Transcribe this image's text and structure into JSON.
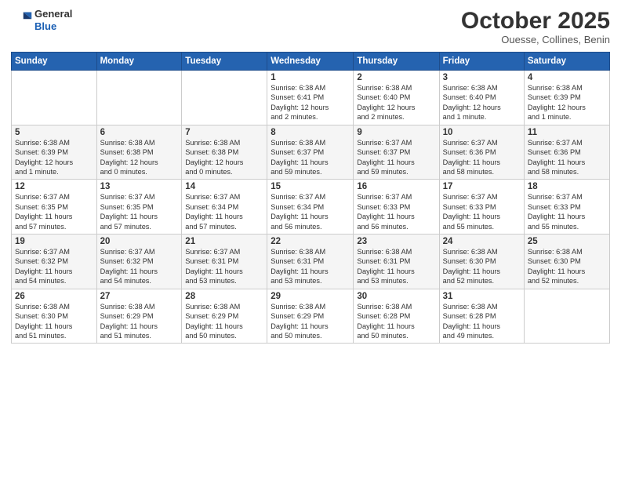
{
  "header": {
    "logo_line1": "General",
    "logo_line2": "Blue",
    "month": "October 2025",
    "location": "Ouesse, Collines, Benin"
  },
  "weekdays": [
    "Sunday",
    "Monday",
    "Tuesday",
    "Wednesday",
    "Thursday",
    "Friday",
    "Saturday"
  ],
  "weeks": [
    [
      {
        "day": "",
        "info": ""
      },
      {
        "day": "",
        "info": ""
      },
      {
        "day": "",
        "info": ""
      },
      {
        "day": "1",
        "info": "Sunrise: 6:38 AM\nSunset: 6:41 PM\nDaylight: 12 hours\nand 2 minutes."
      },
      {
        "day": "2",
        "info": "Sunrise: 6:38 AM\nSunset: 6:40 PM\nDaylight: 12 hours\nand 2 minutes."
      },
      {
        "day": "3",
        "info": "Sunrise: 6:38 AM\nSunset: 6:40 PM\nDaylight: 12 hours\nand 1 minute."
      },
      {
        "day": "4",
        "info": "Sunrise: 6:38 AM\nSunset: 6:39 PM\nDaylight: 12 hours\nand 1 minute."
      }
    ],
    [
      {
        "day": "5",
        "info": "Sunrise: 6:38 AM\nSunset: 6:39 PM\nDaylight: 12 hours\nand 1 minute."
      },
      {
        "day": "6",
        "info": "Sunrise: 6:38 AM\nSunset: 6:38 PM\nDaylight: 12 hours\nand 0 minutes."
      },
      {
        "day": "7",
        "info": "Sunrise: 6:38 AM\nSunset: 6:38 PM\nDaylight: 12 hours\nand 0 minutes."
      },
      {
        "day": "8",
        "info": "Sunrise: 6:38 AM\nSunset: 6:37 PM\nDaylight: 11 hours\nand 59 minutes."
      },
      {
        "day": "9",
        "info": "Sunrise: 6:37 AM\nSunset: 6:37 PM\nDaylight: 11 hours\nand 59 minutes."
      },
      {
        "day": "10",
        "info": "Sunrise: 6:37 AM\nSunset: 6:36 PM\nDaylight: 11 hours\nand 58 minutes."
      },
      {
        "day": "11",
        "info": "Sunrise: 6:37 AM\nSunset: 6:36 PM\nDaylight: 11 hours\nand 58 minutes."
      }
    ],
    [
      {
        "day": "12",
        "info": "Sunrise: 6:37 AM\nSunset: 6:35 PM\nDaylight: 11 hours\nand 57 minutes."
      },
      {
        "day": "13",
        "info": "Sunrise: 6:37 AM\nSunset: 6:35 PM\nDaylight: 11 hours\nand 57 minutes."
      },
      {
        "day": "14",
        "info": "Sunrise: 6:37 AM\nSunset: 6:34 PM\nDaylight: 11 hours\nand 57 minutes."
      },
      {
        "day": "15",
        "info": "Sunrise: 6:37 AM\nSunset: 6:34 PM\nDaylight: 11 hours\nand 56 minutes."
      },
      {
        "day": "16",
        "info": "Sunrise: 6:37 AM\nSunset: 6:33 PM\nDaylight: 11 hours\nand 56 minutes."
      },
      {
        "day": "17",
        "info": "Sunrise: 6:37 AM\nSunset: 6:33 PM\nDaylight: 11 hours\nand 55 minutes."
      },
      {
        "day": "18",
        "info": "Sunrise: 6:37 AM\nSunset: 6:33 PM\nDaylight: 11 hours\nand 55 minutes."
      }
    ],
    [
      {
        "day": "19",
        "info": "Sunrise: 6:37 AM\nSunset: 6:32 PM\nDaylight: 11 hours\nand 54 minutes."
      },
      {
        "day": "20",
        "info": "Sunrise: 6:37 AM\nSunset: 6:32 PM\nDaylight: 11 hours\nand 54 minutes."
      },
      {
        "day": "21",
        "info": "Sunrise: 6:37 AM\nSunset: 6:31 PM\nDaylight: 11 hours\nand 53 minutes."
      },
      {
        "day": "22",
        "info": "Sunrise: 6:38 AM\nSunset: 6:31 PM\nDaylight: 11 hours\nand 53 minutes."
      },
      {
        "day": "23",
        "info": "Sunrise: 6:38 AM\nSunset: 6:31 PM\nDaylight: 11 hours\nand 53 minutes."
      },
      {
        "day": "24",
        "info": "Sunrise: 6:38 AM\nSunset: 6:30 PM\nDaylight: 11 hours\nand 52 minutes."
      },
      {
        "day": "25",
        "info": "Sunrise: 6:38 AM\nSunset: 6:30 PM\nDaylight: 11 hours\nand 52 minutes."
      }
    ],
    [
      {
        "day": "26",
        "info": "Sunrise: 6:38 AM\nSunset: 6:30 PM\nDaylight: 11 hours\nand 51 minutes."
      },
      {
        "day": "27",
        "info": "Sunrise: 6:38 AM\nSunset: 6:29 PM\nDaylight: 11 hours\nand 51 minutes."
      },
      {
        "day": "28",
        "info": "Sunrise: 6:38 AM\nSunset: 6:29 PM\nDaylight: 11 hours\nand 50 minutes."
      },
      {
        "day": "29",
        "info": "Sunrise: 6:38 AM\nSunset: 6:29 PM\nDaylight: 11 hours\nand 50 minutes."
      },
      {
        "day": "30",
        "info": "Sunrise: 6:38 AM\nSunset: 6:28 PM\nDaylight: 11 hours\nand 50 minutes."
      },
      {
        "day": "31",
        "info": "Sunrise: 6:38 AM\nSunset: 6:28 PM\nDaylight: 11 hours\nand 49 minutes."
      },
      {
        "day": "",
        "info": ""
      }
    ]
  ]
}
